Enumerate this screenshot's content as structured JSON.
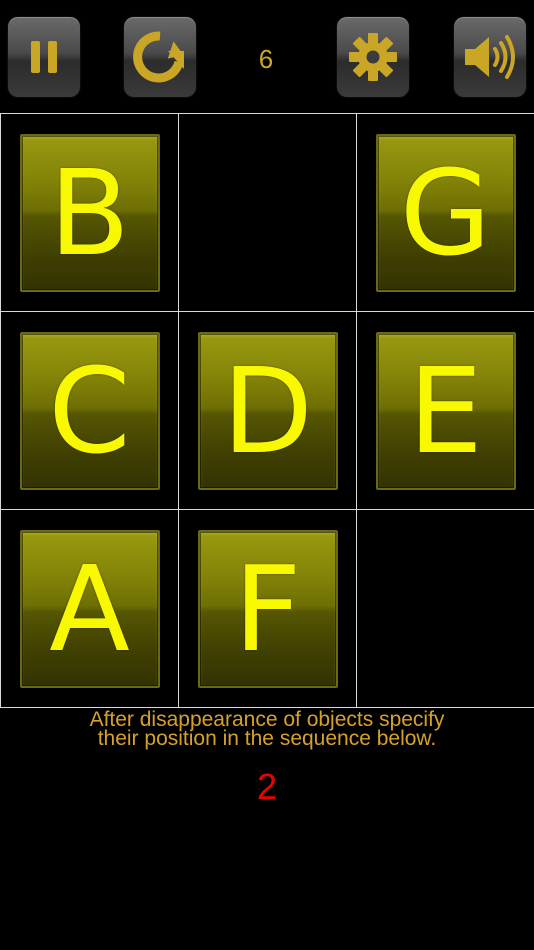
{
  "toolbar": {
    "pause_icon": "pause-icon",
    "restart_icon": "restart-icon",
    "settings_icon": "gear-icon",
    "sound_icon": "speaker-icon",
    "level": "6"
  },
  "grid": {
    "cells": [
      {
        "letter": "B"
      },
      {
        "letter": ""
      },
      {
        "letter": "G"
      },
      {
        "letter": "C"
      },
      {
        "letter": "D"
      },
      {
        "letter": "E"
      },
      {
        "letter": "A"
      },
      {
        "letter": "F"
      },
      {
        "letter": ""
      }
    ]
  },
  "instruction": {
    "line1": "After disappearance of objects specify",
    "line2": "their position in the sequence below."
  },
  "sequence": "2",
  "colors": {
    "icon_gold": "#c9a626",
    "tile_letter": "#f8f800",
    "sequence_red": "#ee0000",
    "instruction_text": "#d6a12a"
  }
}
